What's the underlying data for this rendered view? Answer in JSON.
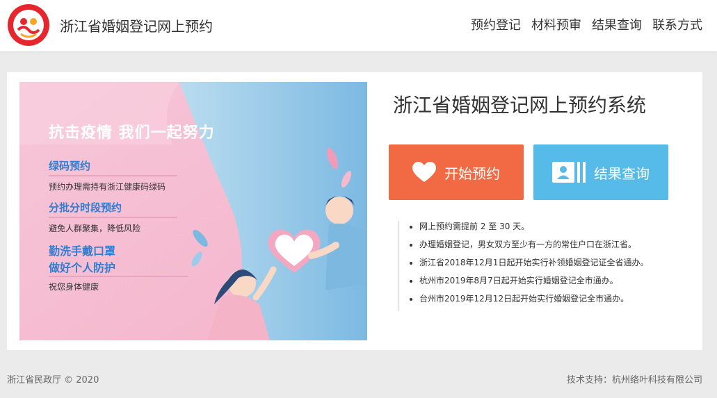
{
  "header": {
    "brand_title": "浙江省婚姻登记网上预约",
    "nav": [
      "预约登记",
      "材料预审",
      "结果查询",
      "联系方式"
    ],
    "logo_color": "#e6262c"
  },
  "banner": {
    "title": "抗击疫情 我们一起努力",
    "sections": [
      {
        "heading": "绿码预约",
        "sub": "预约办理需持有浙江健康码绿码"
      },
      {
        "heading": "分批分时段预约",
        "sub": "避免人群聚集，降低风险"
      },
      {
        "heading": "勤洗手戴口罩",
        "heading2": "做好个人防护",
        "sub": "祝您身体健康"
      }
    ]
  },
  "main": {
    "system_title": "浙江省婚姻登记网上预约系统",
    "start_button": "开始预约",
    "result_button": "结果查询",
    "notes": [
      "网上预约需提前 2 至 30 天。",
      "办理婚姻登记，男女双方至少有一方的常住户口在浙江省。",
      "浙江省2018年12月1日起开始实行补领婚姻登记证全省通办。",
      "杭州市2019年8月7日起开始实行婚姻登记全市通办。",
      "台州市2019年12月12日起开始实行婚姻登记全市通办。"
    ]
  },
  "footer": {
    "copyright": "浙江省民政厅 © 2020",
    "support": "技术支持：杭州络叶科技有限公司"
  },
  "colors": {
    "start_button": "#f16a43",
    "result_button": "#56bbe9",
    "banner_heading": "#2e7fd1"
  }
}
